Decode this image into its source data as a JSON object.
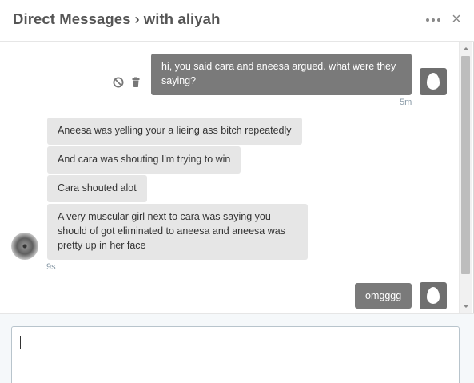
{
  "header": {
    "title": "Direct Messages",
    "separator": "›",
    "conversation": "with aliyah",
    "more_icon": "more-dots-icon",
    "close_label": "×"
  },
  "messages": [
    {
      "sender": "me",
      "text": "hi, you said cara and aneesa argued. what were they saying?",
      "time": "5m"
    },
    {
      "sender": "aliyah",
      "text": "Aneesa was yelling your a lieing ass bitch repeatedly"
    },
    {
      "sender": "aliyah",
      "text": "And cara was shouting I'm trying to win"
    },
    {
      "sender": "aliyah",
      "text": "Cara shouted alot"
    },
    {
      "sender": "aliyah",
      "text": "A very muscular girl next to cara was saying you should of got eliminated to aneesa and aneesa was pretty up in her face",
      "time": "9s"
    },
    {
      "sender": "me",
      "text": "omgggg"
    }
  ],
  "message_actions": {
    "block_icon": "block-icon",
    "delete_icon": "trash-icon"
  },
  "composer": {
    "value": ""
  },
  "colors": {
    "sent_bubble": "#7a7a7a",
    "received_bubble": "#e6e6e6",
    "timestamp": "#8899a6"
  }
}
